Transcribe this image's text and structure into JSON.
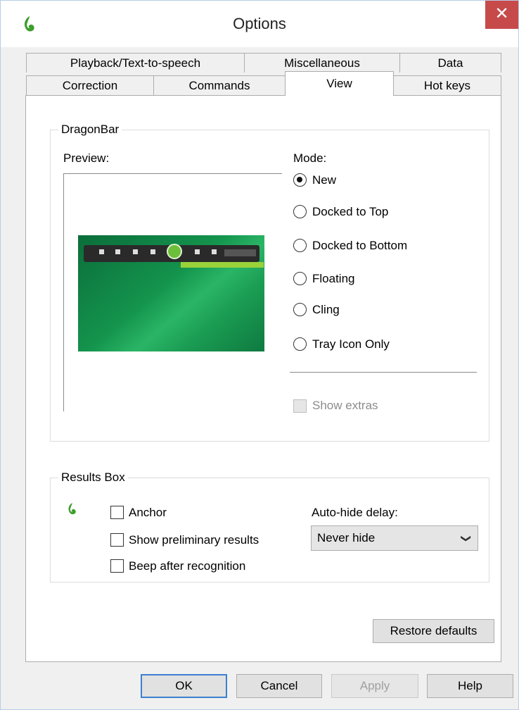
{
  "window": {
    "title": "Options",
    "close_glyph": "✕",
    "app_icon": "dragon-flame-icon",
    "accent": "#3c7fd1",
    "close_color": "#c74a4a",
    "flame_color": "#3e9e2c"
  },
  "tabs": {
    "row1": [
      "Playback/Text-to-speech",
      "Miscellaneous",
      "Data"
    ],
    "row2": [
      "Correction",
      "Commands",
      "View",
      "Hot keys"
    ],
    "active": "View"
  },
  "dragonbar": {
    "group_label": "DragonBar",
    "preview_label": "Preview:",
    "mode_label": "Mode:",
    "modes": [
      {
        "label": "New",
        "checked": true
      },
      {
        "label": "Docked to Top",
        "checked": false
      },
      {
        "label": "Docked to Bottom",
        "checked": false
      },
      {
        "label": "Floating",
        "checked": false
      },
      {
        "label": "Cling",
        "checked": false
      },
      {
        "label": "Tray Icon Only",
        "checked": false
      }
    ],
    "show_extras": {
      "label": "Show extras",
      "checked": false,
      "enabled": false
    }
  },
  "results_box": {
    "group_label": "Results Box",
    "anchor": {
      "label": "Anchor",
      "checked": false
    },
    "show_preliminary": {
      "label": "Show preliminary results",
      "checked": false
    },
    "beep": {
      "label": "Beep after recognition",
      "checked": false
    },
    "autohide_label": "Auto-hide delay:",
    "autohide_value": "Never hide"
  },
  "buttons": {
    "restore": "Restore defaults",
    "ok": "OK",
    "cancel": "Cancel",
    "apply": "Apply",
    "help": "Help"
  }
}
